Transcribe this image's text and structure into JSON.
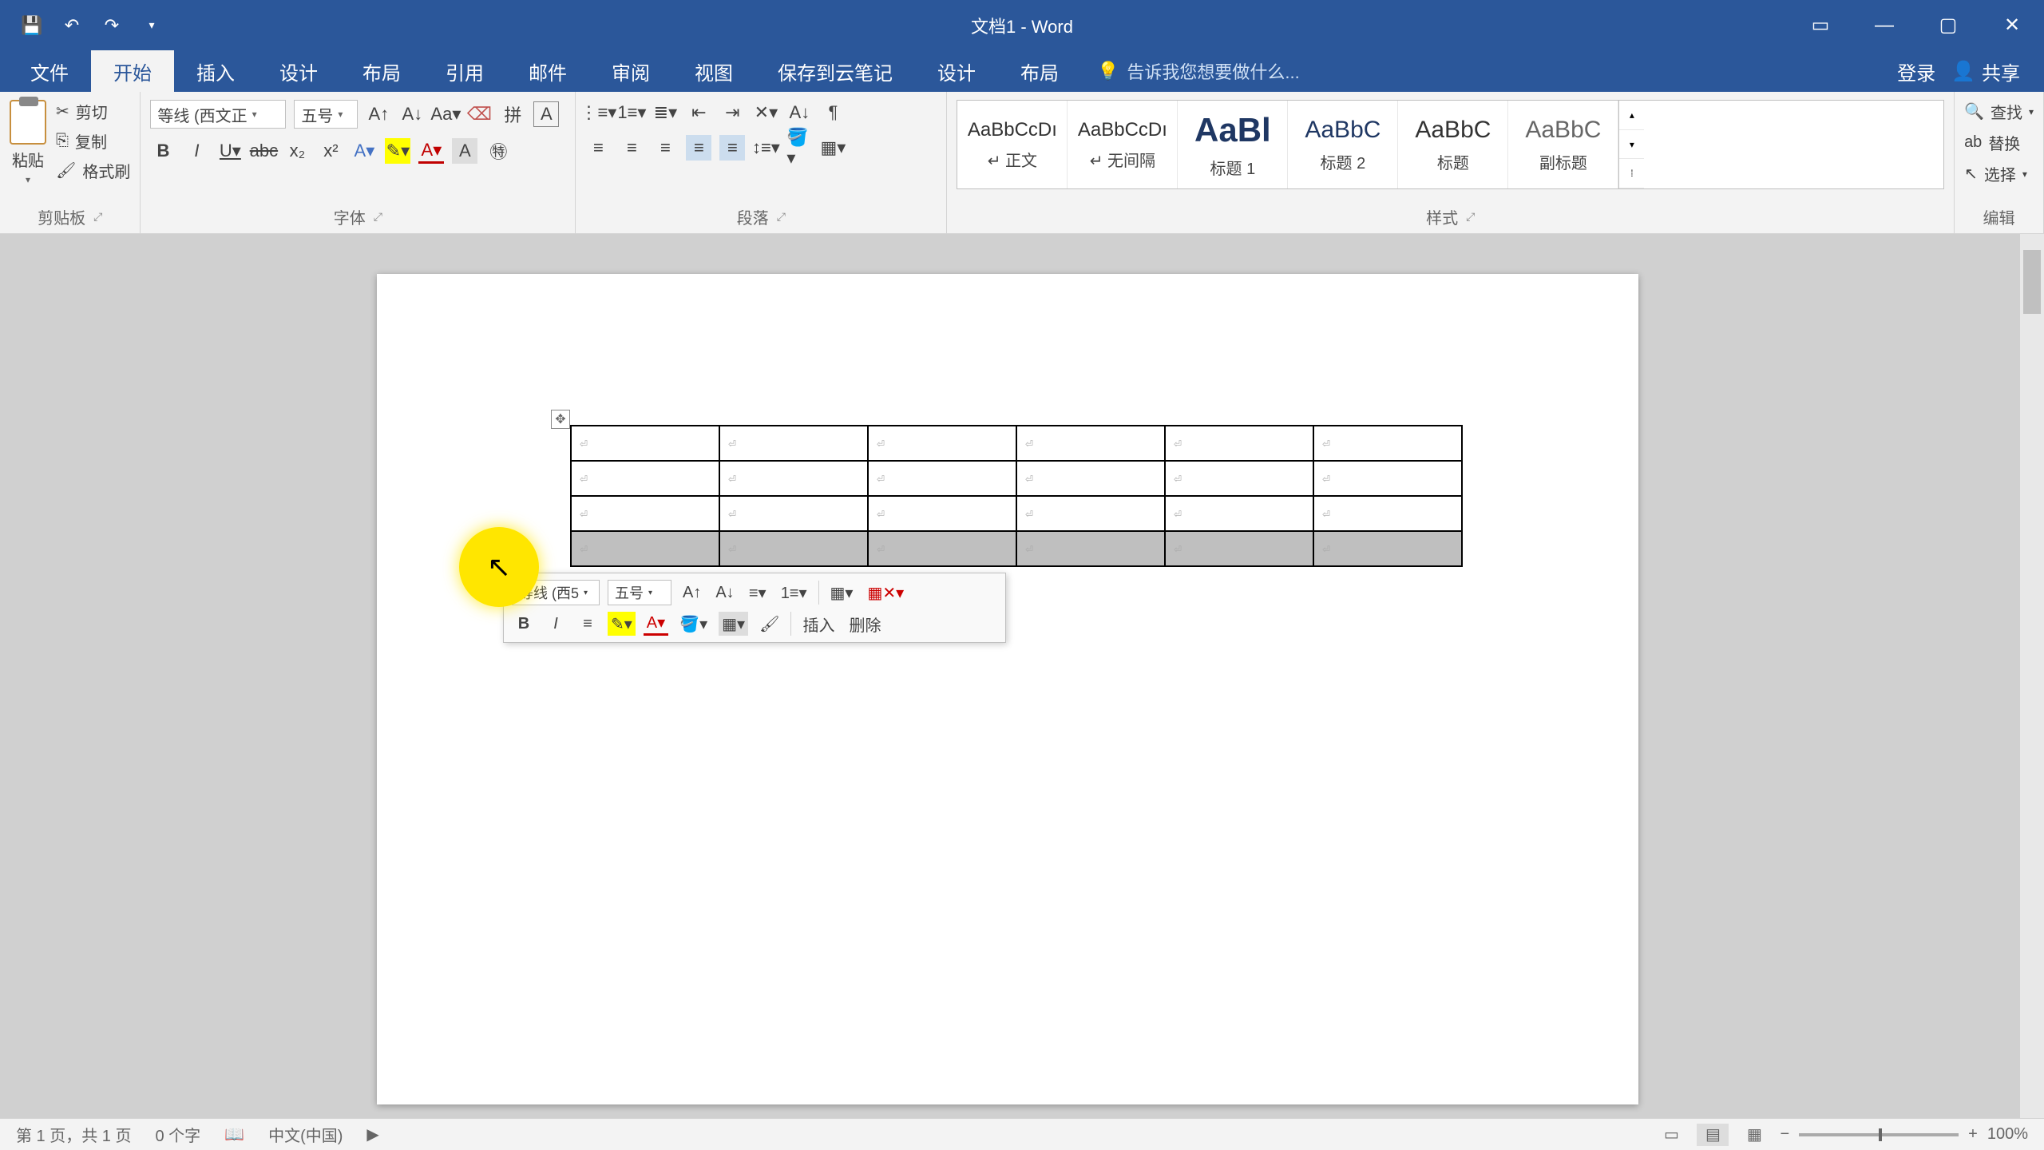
{
  "title": "文档1 - Word",
  "tabs": {
    "file": "文件",
    "home": "开始",
    "insert": "插入",
    "design": "设计",
    "layout": "布局",
    "references": "引用",
    "mailings": "邮件",
    "review": "审阅",
    "view": "视图",
    "save_cloud": "保存到云笔记",
    "table_design": "设计",
    "table_layout": "布局"
  },
  "tell_me": "告诉我您想要做什么...",
  "login": "登录",
  "share": "共享",
  "clipboard": {
    "paste": "粘贴",
    "cut": "剪切",
    "copy": "复制",
    "format_painter": "格式刷",
    "group": "剪贴板"
  },
  "font": {
    "name": "等线 (西文正",
    "size": "五号",
    "group": "字体"
  },
  "paragraph": {
    "group": "段落"
  },
  "styles": {
    "group": "样式",
    "items": [
      {
        "preview": "AaBbCcDı",
        "name": "↵ 正文"
      },
      {
        "preview": "AaBbCcDı",
        "name": "↵ 无间隔"
      },
      {
        "preview": "AaBl",
        "name": "标题 1"
      },
      {
        "preview": "AaBbC",
        "name": "标题 2"
      },
      {
        "preview": "AaBbC",
        "name": "标题"
      },
      {
        "preview": "AaBbC",
        "name": "副标题"
      }
    ]
  },
  "editing": {
    "find": "查找",
    "replace": "替换",
    "select": "选择",
    "group": "编辑"
  },
  "mini": {
    "font": "等线 (西5",
    "size": "五号",
    "insert": "插入",
    "delete": "删除"
  },
  "status": {
    "page": "第 1 页，共 1 页",
    "words": "0 个字",
    "lang": "中文(中国)",
    "zoom": "100%"
  },
  "table": {
    "rows": 4,
    "cols": 6,
    "selected_row": 3
  }
}
